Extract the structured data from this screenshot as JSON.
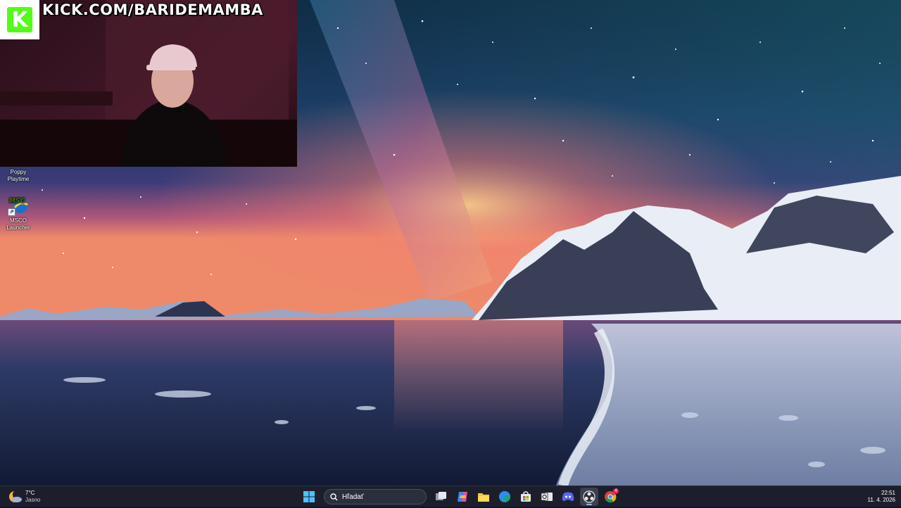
{
  "stream_overlay": {
    "channel_url": "KICK.COM/BARIDEMAMBA",
    "logo_letter": "K",
    "accent_color": "#53fc18"
  },
  "desktop_icons": [
    {
      "label_line1": "Poppy",
      "label_line2": "Playtime"
    },
    {
      "label_line1": "MSCO",
      "label_line2": "Launcher",
      "icon_text": "MSC"
    }
  ],
  "taskbar": {
    "weather": {
      "temperature": "7°C",
      "condition": "Jasno"
    },
    "search": {
      "placeholder": "Hľadať"
    },
    "clock": {
      "time": "22:51",
      "date": "11. 4. 2026"
    },
    "pinned_apps": [
      "start-icon",
      "task-view-icon",
      "copilot-icon",
      "file-explorer-icon",
      "edge-icon",
      "store-icon",
      "outlook-icon",
      "discord-icon",
      "obs-icon",
      "chrome-icon"
    ],
    "chrome_badge_count": "4"
  }
}
